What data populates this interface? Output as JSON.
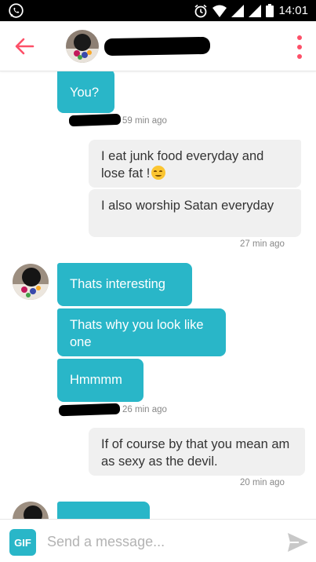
{
  "status_bar": {
    "time": "14:01",
    "icons": [
      "whatsapp-icon",
      "alarm-icon",
      "wifi-icon",
      "signal-icon",
      "signal-icon",
      "battery-icon"
    ]
  },
  "header": {
    "back_icon": "arrow-left-icon",
    "menu_icon": "more-vertical-icon",
    "accent_color": "#fd5068"
  },
  "messages": [
    {
      "direction": "incoming",
      "text": "You?",
      "time": "59 min ago"
    },
    {
      "direction": "outgoing",
      "text": "I eat junk food everyday and lose fat !",
      "emoji": "smiling-face-icon"
    },
    {
      "direction": "outgoing",
      "text": "I also worship Satan everyday",
      "time": "27 min ago"
    },
    {
      "direction": "incoming",
      "text": "Thats interesting"
    },
    {
      "direction": "incoming",
      "text": "Thats why you look like one"
    },
    {
      "direction": "incoming",
      "text": "Hmmmm",
      "time": "26 min ago"
    },
    {
      "direction": "outgoing",
      "text": "If of course by that you mean am as sexy as the devil.",
      "time": "20 min ago"
    }
  ],
  "colors": {
    "incoming_bubble": "#29b6c8",
    "outgoing_bubble": "#f0f0f0"
  },
  "composer": {
    "gif_label": "GIF",
    "placeholder": "Send a message...",
    "send_icon": "send-icon"
  }
}
